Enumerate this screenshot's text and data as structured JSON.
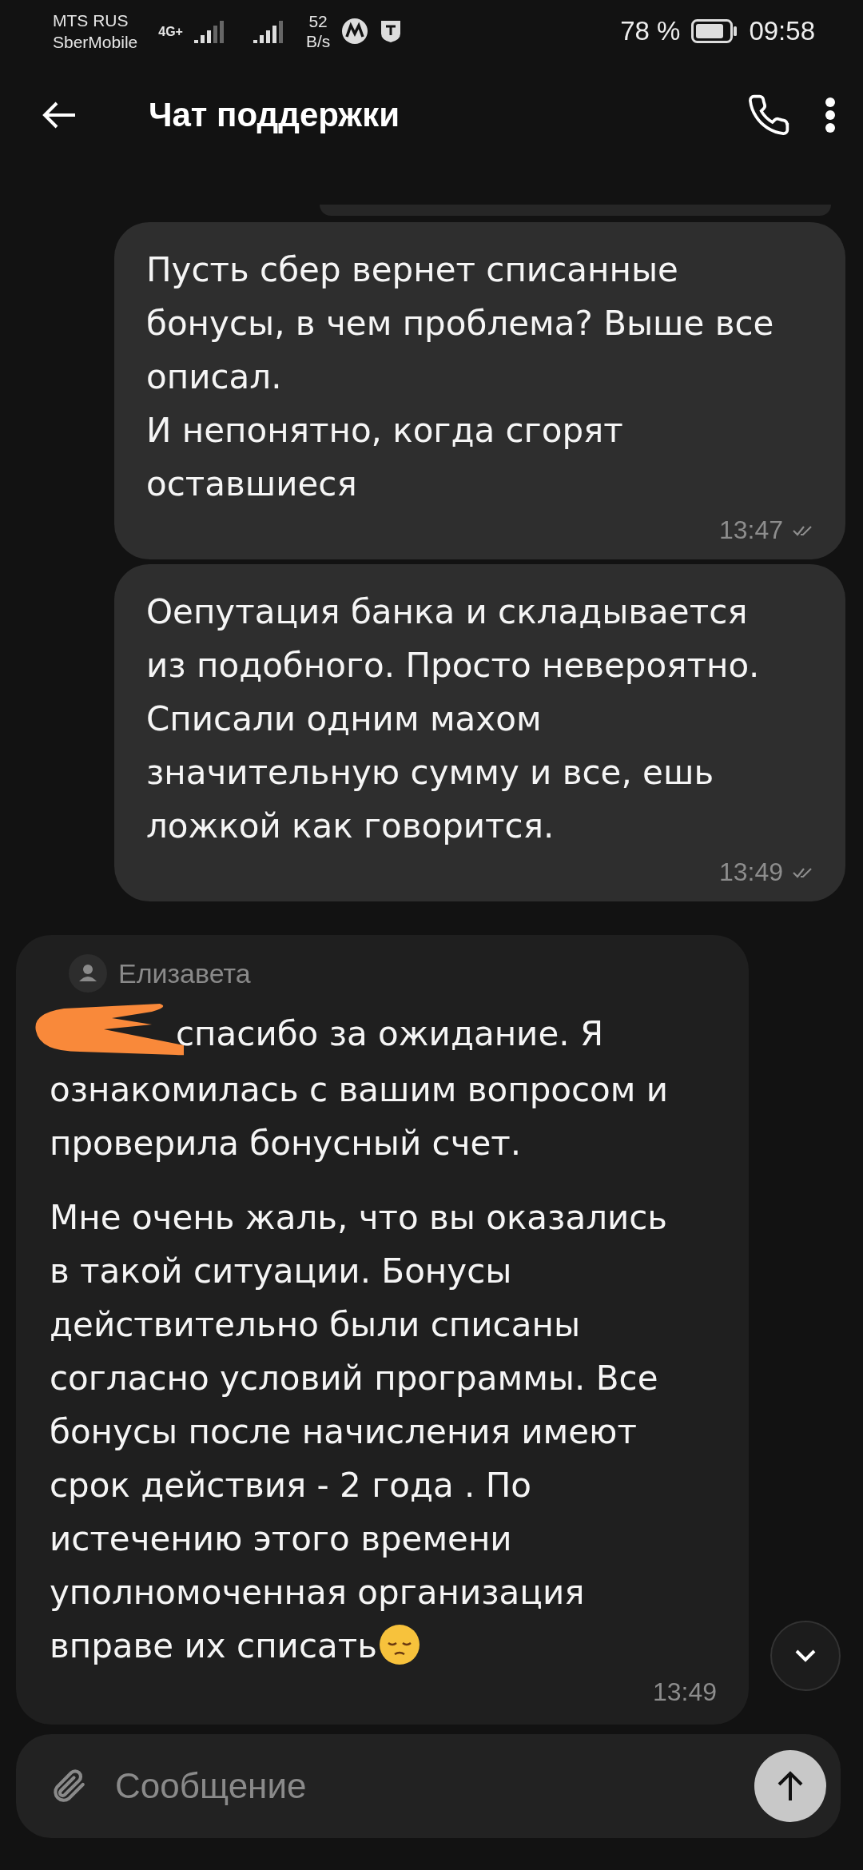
{
  "status_bar": {
    "carrier_1": "MTS RUS",
    "carrier_2": "SberMobile",
    "network": "4G+",
    "speed_value": "52",
    "speed_unit": "B/s",
    "battery_percent": "78 %",
    "time": "09:58"
  },
  "header": {
    "title": "Чат поддержки"
  },
  "messages": [
    {
      "kind": "outgoing",
      "paragraphs": [
        "Пусть сбер вернет списанные бонусы, в чем проблема? Выше все описал.\nИ непонятно, когда сгорят оставшиеся"
      ],
      "time": "13:47",
      "read": true
    },
    {
      "kind": "outgoing",
      "paragraphs": [
        "Оепутация банка и складывается из подобного. Просто невероятно. Списали одним махом значительную сумму и все, ешь ложкой как говорится."
      ],
      "time": "13:49",
      "read": true
    },
    {
      "kind": "incoming",
      "sender": "Елизавета",
      "redacted_start": true,
      "paragraphs": [
        "спасибо за ожидание. Я ознакомилась с вашим вопросом и проверила бонусный счет.",
        "Мне очень жаль, что вы оказались в такой ситуации. Бонусы действительно были списаны согласно условий программы. Все бонусы после начисления имеют срок действия - 2 года . По истечению этого времени уполномоченная организация вправе их списать"
      ],
      "ends_with_emoji": true,
      "time": "13:49"
    }
  ],
  "composer": {
    "placeholder": "Сообщение"
  }
}
